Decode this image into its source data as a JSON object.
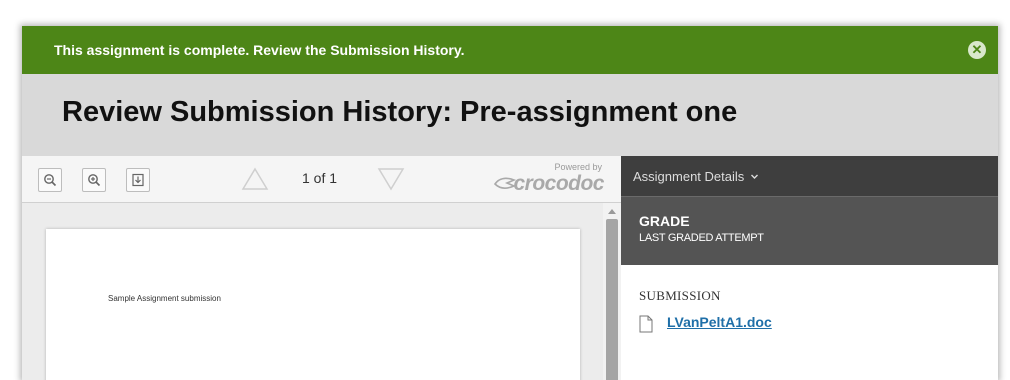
{
  "banner": {
    "message": "This assignment is complete. Review the Submission History.",
    "close_icon": "close-icon",
    "color": "#4d8617"
  },
  "header": {
    "title": "Review Submission History: Pre-assignment one"
  },
  "viewer": {
    "toolbar": {
      "zoom_out_icon": "zoom-out-icon",
      "zoom_in_icon": "zoom-in-icon",
      "download_icon": "download-icon",
      "prev_icon": "triangle-up-icon",
      "next_icon": "triangle-down-icon",
      "page_indicator": "1 of 1",
      "powered_by": "Powered by",
      "brand": "crocodoc"
    },
    "document": {
      "text": "Sample Assignment submission"
    }
  },
  "details": {
    "header_label": "Assignment Details",
    "header_chevron": "chevron-down-icon",
    "grade": {
      "title": "GRADE",
      "subtitle": "LAST GRADED ATTEMPT"
    },
    "submission": {
      "label": "SUBMISSION",
      "file_icon": "document-icon",
      "file_name": "LVanPeltA1.doc",
      "link_color": "#1f6fa8"
    }
  }
}
